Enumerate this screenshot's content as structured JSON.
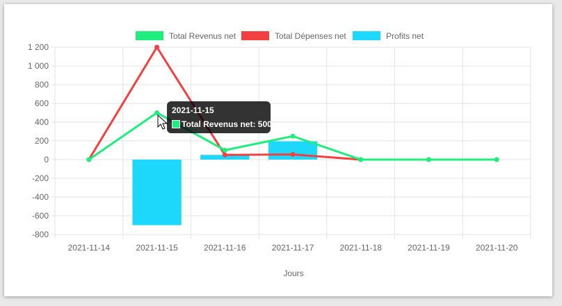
{
  "chart_data": {
    "type": "bar",
    "categories": [
      "2021-11-14",
      "2021-11-15",
      "2021-11-16",
      "2021-11-17",
      "2021-11-18",
      "2021-11-19",
      "2021-11-20"
    ],
    "series": [
      {
        "name": "Total Revenus net",
        "type": "line",
        "color": "#1fee7e",
        "values": [
          0,
          500,
          100,
          250,
          0,
          0,
          0
        ]
      },
      {
        "name": "Total Dépenses net",
        "type": "line",
        "color": "#f23f3f",
        "values": [
          0,
          1200,
          50,
          55,
          0,
          0,
          0
        ]
      },
      {
        "name": "Profits net",
        "type": "bar",
        "color": "#1ed8fc",
        "values": [
          0,
          -700,
          50,
          195,
          0,
          0,
          0
        ]
      }
    ],
    "xlabel": "Jours",
    "ylabel": "",
    "ylim": [
      -800,
      1200
    ],
    "yticks": [
      "1 200",
      "1 000",
      "800",
      "600",
      "400",
      "200",
      "0",
      "-200",
      "-400",
      "-600",
      "-800"
    ],
    "ytick_values": [
      1200,
      1000,
      800,
      600,
      400,
      200,
      0,
      -200,
      -400,
      -600,
      -800
    ],
    "grid": true,
    "legend_position": "top"
  },
  "tooltip": {
    "title": "2021-11-15",
    "body": "Total Revenus net: 500",
    "color": "#1fee7e"
  }
}
